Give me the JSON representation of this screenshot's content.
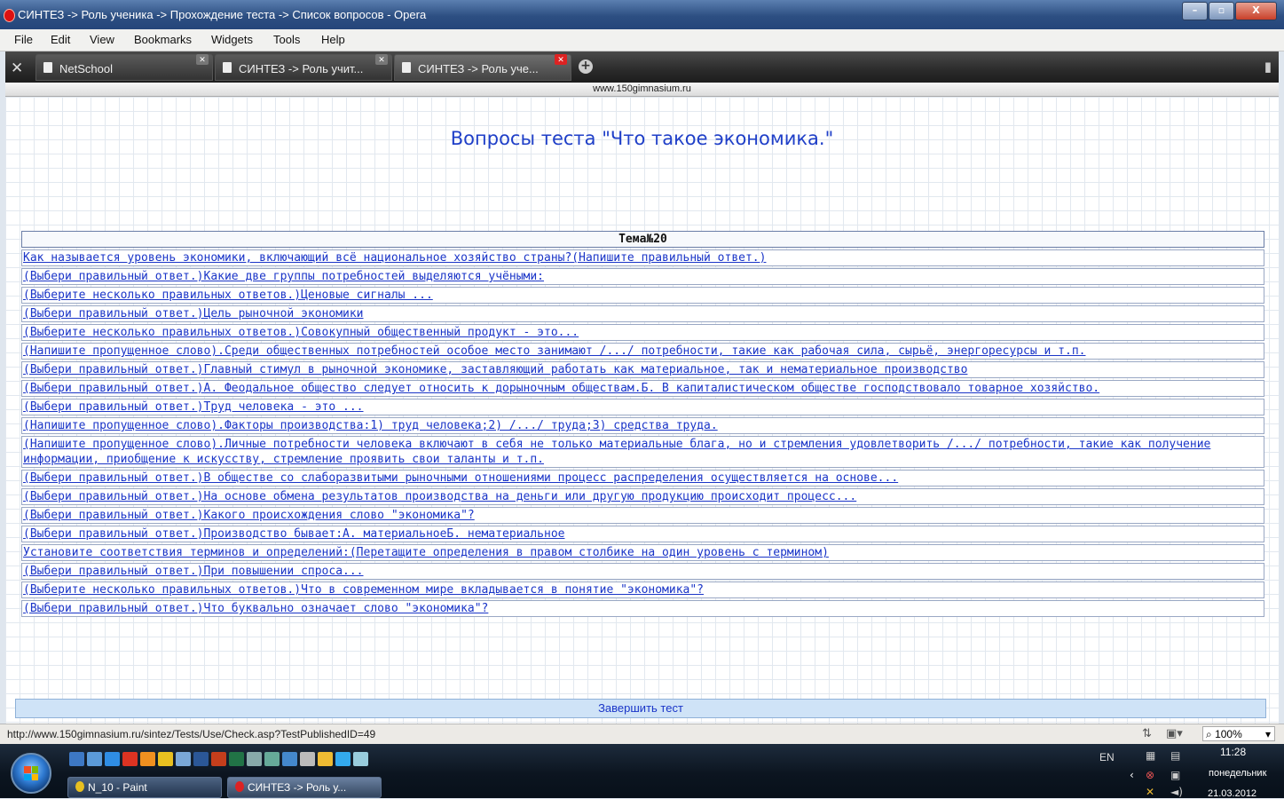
{
  "window": {
    "title": "СИНТЕЗ -> Роль ученика -> Прохождение теста -> Список вопросов - Opera",
    "min": "–",
    "max": "▫",
    "close": "X"
  },
  "menu": [
    "File",
    "Edit",
    "View",
    "Bookmarks",
    "Widgets",
    "Tools",
    "Help"
  ],
  "tabs": [
    {
      "label": "NetSchool"
    },
    {
      "label": "СИНТЕЗ -> Роль учит..."
    },
    {
      "label": "СИНТЕЗ -> Роль уче..."
    }
  ],
  "address": "www.150gimnasium.ru",
  "page": {
    "heading": "Вопросы теста \"Что такое экономика.\"",
    "topic": "Тема№20",
    "questions": [
      "Как называется уровень экономики, включающий всё национальное хозяйство страны?(Напишите правильный ответ.)",
      "(Выбери правильный ответ.)Какие две группы потребностей выделяются учёными:",
      "(Выберите несколько правильных ответов.)Ценовые сигналы ...",
      "(Выбери правильный ответ.)Цель рыночной экономики",
      "(Выберите несколько правильных ответов.)Совокупный общественный продукт - это...",
      "(Напишите пропущенное слово).Среди общественных потребностей особое место занимают /.../ потребности, такие как рабочая сила, сырьё, энергоресурсы и т.п.",
      "(Выбери правильный ответ.)Главный стимул в рыночной экономике, заставляющий работать как материальное, так и нематериальное производство",
      "(Выбери правильный ответ.)А. Феодальное общество следует относить к дорыночным обществам.Б. В капиталистическом обществе господствовало товарное хозяйство.",
      "(Выбери правильный ответ.)Труд человека - это ...",
      "(Напишите пропущенное слово).Факторы производства:1) труд человека;2) /.../ труда;3) средства труда.",
      "(Напишите пропущенное слово).Личные потребности человека включают в себя не только материальные блага, но и стремления удовлетворить /.../ потребности, такие как получение информации, приобщение к искусству, стремление проявить свои таланты и т.п.",
      "(Выбери правильный ответ.)В обществе со слаборазвитыми рыночными отношениями процесс распределения осуществляется на основе...",
      "(Выбери правильный ответ.)На основе обмена результатов производства на деньги или другую продукцию происходит процесс...",
      "(Выбери правильный ответ.)Какого происхождения слово \"экономика\"?",
      "(Выбери правильный ответ.)Производство бывает:А. материальноеБ. нематериальное",
      "Установите соответствия терминов и определений:(Перетащите определения в правом столбике на один уровень с термином)",
      "(Выбери правильный ответ.)При повышении спроса...",
      "(Выберите несколько правильных ответов.)Что в современном мире вкладывается в понятие \"экономика\"?",
      "(Выбери правильный ответ.)Что буквально означает слово \"экономика\"?"
    ],
    "finish_label": "Завершить тест"
  },
  "status": {
    "url": "http://www.150gimnasium.ru/sintez/Tests/Use/Check.asp?TestPublishedID=49",
    "zoom": "100%"
  },
  "taskbar": {
    "tasks": [
      "N_10 - Paint",
      "СИНТЕЗ -> Роль у..."
    ],
    "lang": "EN",
    "time": "11:28",
    "day": "понедельник",
    "date": "21.03.2012"
  }
}
